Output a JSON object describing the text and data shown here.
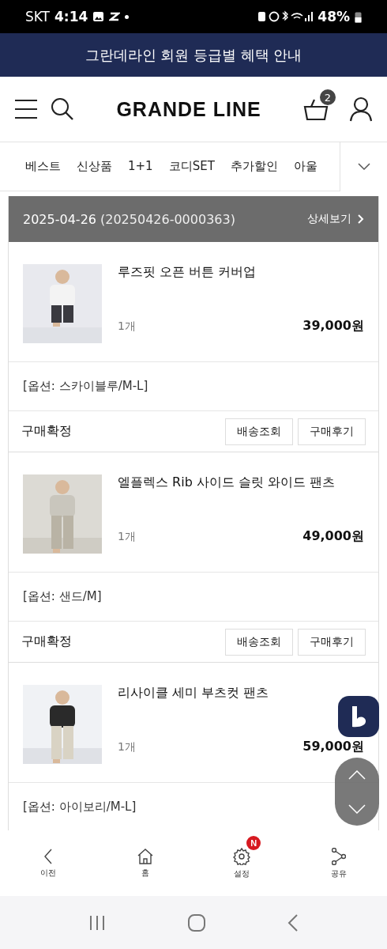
{
  "status_bar": {
    "carrier": "SKT",
    "time": "4:14",
    "battery": "48%"
  },
  "banner": {
    "text": "그란데라인 회원 등급별 혜택 안내"
  },
  "header": {
    "logo": "GRANDE LINE",
    "cart_count": "2"
  },
  "categories": [
    {
      "label": "베스트"
    },
    {
      "label": "신상품"
    },
    {
      "label": "1+1"
    },
    {
      "label": "코디SET"
    },
    {
      "label": "추가할인"
    },
    {
      "label": "아울"
    }
  ],
  "order": {
    "date": "2025-04-26",
    "number": "(20250426-0000363)",
    "detail_link": "상세보기"
  },
  "items": [
    {
      "name": "루즈핏 오픈 버튼 커버업",
      "quantity": "1개",
      "price": "39,000원",
      "option": "[옵션: 스카이블루/M-L]",
      "status": "구매확정",
      "buttons": [
        "배송조회",
        "구매후기"
      ]
    },
    {
      "name": "엘플렉스 Rib 사이드 슬릿 와이드 팬츠",
      "quantity": "1개",
      "price": "49,000원",
      "option": "[옵션: 샌드/M]",
      "status": "구매확정",
      "buttons": [
        "배송조회",
        "구매후기"
      ]
    },
    {
      "name": "리사이클 세미 부츠컷 팬츠",
      "quantity": "1개",
      "price": "59,000원",
      "option": "[옵션: 아이보리/M-L]"
    }
  ],
  "bottom_nav": [
    {
      "label": "이전"
    },
    {
      "label": "홈"
    },
    {
      "label": "설정",
      "badge": "N"
    },
    {
      "label": "공유"
    }
  ]
}
